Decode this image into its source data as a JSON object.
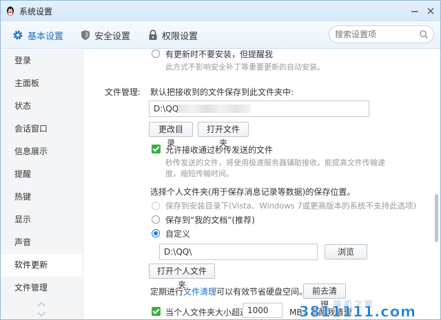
{
  "window": {
    "title": "系统设置"
  },
  "tabs": [
    {
      "label": "基本设置"
    },
    {
      "label": "安全设置"
    },
    {
      "label": "权限设置"
    }
  ],
  "search": {
    "placeholder": "搜索设置项"
  },
  "sidebar": {
    "items": [
      {
        "label": "登录"
      },
      {
        "label": "主面板"
      },
      {
        "label": "状态"
      },
      {
        "label": "会话窗口"
      },
      {
        "label": "信息展示"
      },
      {
        "label": "提醒"
      },
      {
        "label": "热键"
      },
      {
        "label": "显示"
      },
      {
        "label": "声音"
      },
      {
        "label": "软件更新"
      },
      {
        "label": "文件管理"
      }
    ],
    "active": "软件更新"
  },
  "content": {
    "update_option": {
      "label": "有更新时不要安装，但提醒我",
      "hint": "此方式不影响安全补丁等重要更新的自动安装。"
    },
    "file_mgmt": {
      "section_label": "文件管理:",
      "default_path_label": "默认把接收到的文件保存到此文件夹中:",
      "default_path_value": "D:\\QQ",
      "change_dir_button": "更改目录",
      "open_folder_button": "打开文件夹",
      "allow_flash_label": "允许接收通过秒传发送的文件",
      "allow_flash_hint_1": "秒传发送的文件，将使用极速服务器辅助接收。能提高文件传输速",
      "allow_flash_hint_2": "度，缩短传输时间。",
      "personal_folder_label": "选择个人文件夹(用于保存消息记录等数据)的保存位置。",
      "radio_install_dir": "保存到安装目录下(Vista、Windows 7或更高版本的系统不支持此选项)",
      "radio_my_docs": "保存到“我的文档”(推荐)",
      "radio_custom": "自定义",
      "custom_path_value": "D:\\QQ\\",
      "browse_button": "浏览",
      "open_personal_button": "打开个人文件夹",
      "cleanup_prefix": "定期进行",
      "cleanup_link": "文件清理",
      "cleanup_suffix": "可以有效节省硬盘空间。",
      "cleanup_button": "前去清理",
      "size_check_label": "当个人文件夹大小超过",
      "size_value": "1000",
      "size_suffix": "MB，提醒我清理"
    }
  },
  "watermark": {
    "text": "3811111.com",
    "subtext": "装机之家"
  },
  "colors": {
    "accent": "#1a6fc9",
    "checkbox": "#3fae3f",
    "titlebar": "#d5e7f7"
  }
}
